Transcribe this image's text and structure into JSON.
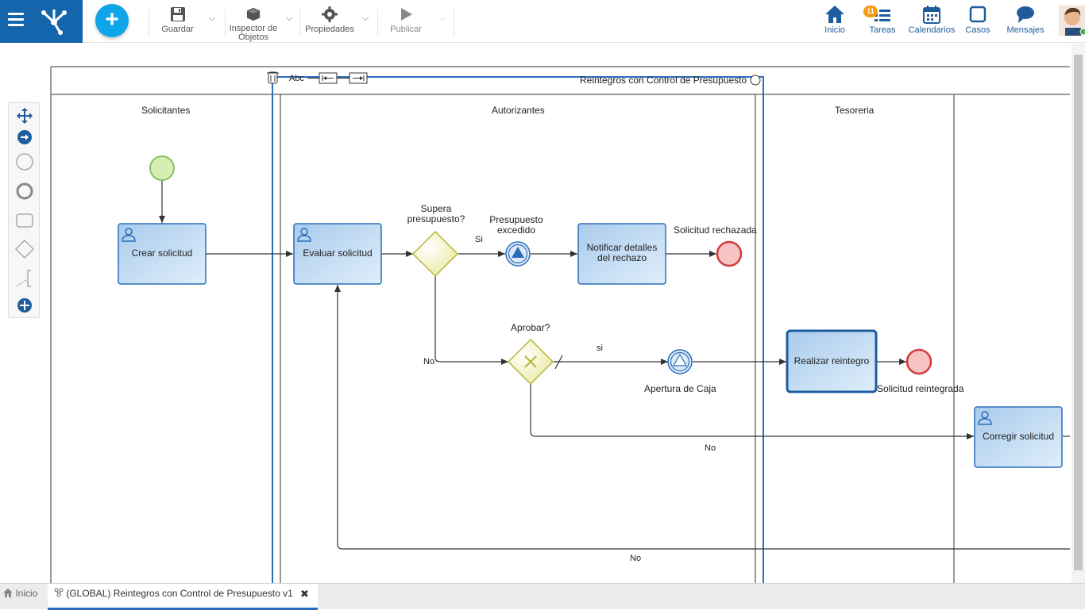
{
  "toolbar": {
    "save": "Guardar",
    "inspector": "Inspector de Objetos",
    "properties": "Propiedades",
    "publish": "Publicar"
  },
  "nav": {
    "home": "Inicio",
    "tasks": "Tareas",
    "tasks_badge": "11",
    "calendars": "Calendarios",
    "cases": "Casos",
    "messages": "Mensajes"
  },
  "diagram": {
    "pool_title": "Reintegros con Control de Presupuesto",
    "edit_text_tool": "Abc",
    "lanes": [
      "Solicitantes",
      "Autorizantes",
      "Tesoreria"
    ],
    "tasks": {
      "create": "Crear solicitud",
      "evaluate": "Evaluar solicitud",
      "notify": "Notificar detalles del rechazo",
      "refund": "Realizar reintegro",
      "correct": "Corregir solicitud"
    },
    "gateways": {
      "budget": "Supera presupuesto?",
      "approve": "Aprobar?"
    },
    "events": {
      "budget_exceeded": "Presupuesto excedido",
      "rejected": "Solicitud rechazada",
      "cash_open": "Apertura de Caja",
      "refunded": "Solicitud reintegrada"
    },
    "flows": {
      "si1": "Si",
      "no1": "No",
      "si2": "si",
      "no2": "No",
      "no3": "No"
    }
  },
  "tabs": {
    "home": "Inicio",
    "process": "(GLOBAL) Reintegros con Control de Presupuesto v1"
  },
  "colors": {
    "brand": "#1565ad",
    "add": "#0ea5e9",
    "task_fill": "#bcd8f0",
    "task_stroke": "#2a6ebb",
    "gateway": "#f4f4b4",
    "end": "#f7c3c3"
  }
}
